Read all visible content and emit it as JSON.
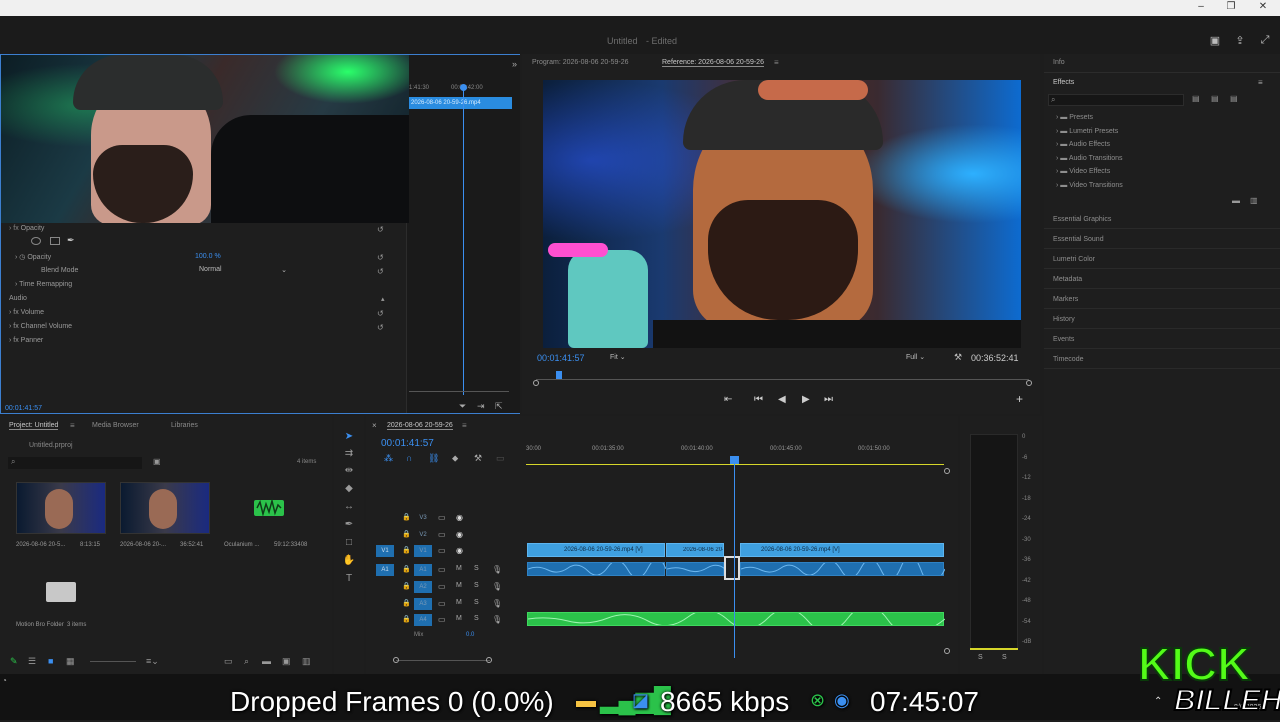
{
  "window": {
    "title": "Untitled",
    "edited": "- Edited",
    "controls": [
      "–",
      "❐",
      "✕"
    ]
  },
  "effect_controls": {
    "clip_tab": "2026-08-06 20-59-26.mp4",
    "ruler_time_a": "1:41:30",
    "ruler_time_b": "00:01:42:00",
    "opacity_section": "Opacity",
    "opacity_label": "Opacity",
    "opacity_value": "100.0 %",
    "blend_mode_label": "Blend Mode",
    "blend_mode_value": "Normal",
    "time_remapping": "Time Remapping",
    "audio_section": "Audio",
    "volume": "Volume",
    "channel_volume": "Channel Volume",
    "panner": "Panner",
    "timecode": "00:01:41:57"
  },
  "program_monitor": {
    "tab_program": "Program: 2026-08-06 20-59-26",
    "tab_reference": "Reference: 2026-08-06 20-59-26",
    "timecode": "00:01:41:57",
    "fit": "Fit",
    "quality": "Full",
    "duration": "00:36:52:41",
    "playhead_fraction": 0.04
  },
  "right_panel": {
    "info": "Info",
    "effects": "Effects",
    "effect_folders": [
      "Presets",
      "Lumetri Presets",
      "Audio Effects",
      "Audio Transitions",
      "Video Effects",
      "Video Transitions"
    ],
    "panels": [
      "Essential Graphics",
      "Essential Sound",
      "Lumetri Color",
      "Metadata",
      "Markers",
      "History",
      "Events",
      "Timecode"
    ]
  },
  "project": {
    "tab_project": "Project: Untitled",
    "tab_media": "Media Browser",
    "tab_libraries": "Libraries",
    "project_file": "Untitled.prproj",
    "item_count": "4 items",
    "items": [
      {
        "name": "2026-08-06 20-5...",
        "duration": "8:13:15"
      },
      {
        "name": "2026-08-06 20-...",
        "duration": "36:52:41"
      },
      {
        "name": "Oculanium ...",
        "duration": "59:12:33408"
      }
    ],
    "folder": {
      "name": "Motion Bro Folder",
      "count": "3 items"
    }
  },
  "timeline": {
    "sequence_tab": "2026-08-06 20-59-26",
    "timecode": "00:01:41:57",
    "ruler_labels": [
      "30:00",
      "00:01:35:00",
      "00:01:40:00",
      "00:01:45:00",
      "00:01:50:00"
    ],
    "video_tracks": [
      "V3",
      "V2",
      "V1"
    ],
    "audio_tracks": [
      "A1",
      "A2",
      "A3",
      "A4"
    ],
    "source_v": "V1",
    "source_a": "A1",
    "mix_label": "Mix",
    "mix_value": "0.0",
    "clips_v1": [
      "2026-08-06 20-59-26.mp4 [V]",
      "2026-08-06 20-59-26.mp4 [V]",
      "2026-08-06 20-59-26.mp4 [V]"
    ]
  },
  "meters": {
    "scale": [
      "0",
      "-6",
      "-12",
      "-18",
      "-24",
      "-30",
      "-36",
      "-42",
      "-48",
      "-54",
      "-dB"
    ],
    "solo_l": "S",
    "solo_r": "S"
  },
  "stream_overlay": {
    "dropped_frames": "Dropped Frames 0 (0.0%)",
    "bitrate": "8665 kbps",
    "clock": "07:45:07",
    "tray_date": "8/6/2026"
  },
  "logo": {
    "word": "KICK",
    "name": "BILLEH"
  },
  "colors": {
    "accent": "#3b8ff0",
    "clip_video": "#3fa0e0",
    "clip_audio": "#1f6fb0",
    "clip_green": "#2bc24a",
    "kick_green": "#53fc18"
  }
}
